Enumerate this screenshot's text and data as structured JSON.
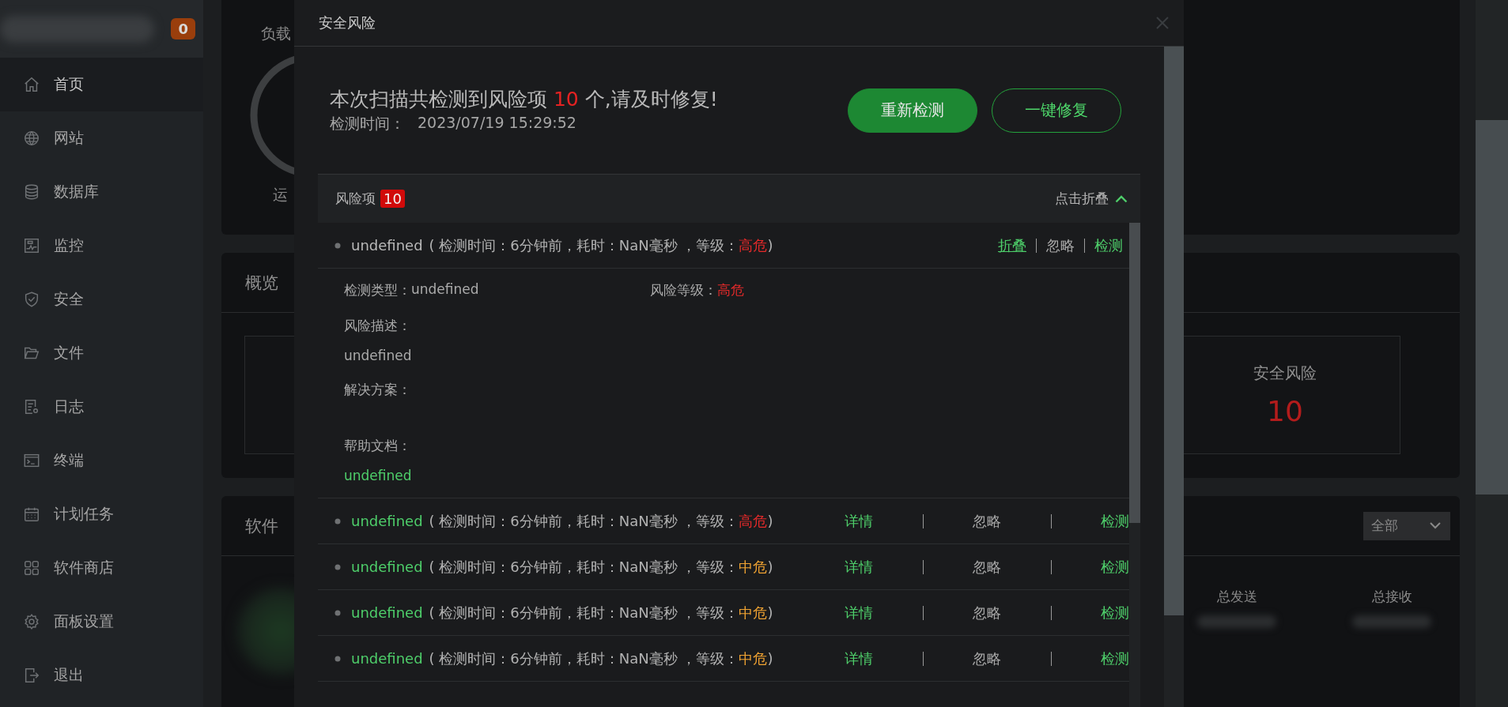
{
  "sidebar": {
    "badge": "0",
    "items": [
      {
        "label": "首页",
        "selected": true
      },
      {
        "label": "网站",
        "selected": false
      },
      {
        "label": "数据库",
        "selected": false
      },
      {
        "label": "监控",
        "selected": false
      },
      {
        "label": "安全",
        "selected": false
      },
      {
        "label": "文件",
        "selected": false
      },
      {
        "label": "日志",
        "selected": false
      },
      {
        "label": "终端",
        "selected": false
      },
      {
        "label": "计划任务",
        "selected": false
      },
      {
        "label": "软件商店",
        "selected": false
      },
      {
        "label": "面板设置",
        "selected": false
      },
      {
        "label": "退出",
        "selected": false
      }
    ]
  },
  "background": {
    "load_title": "负载",
    "load_caption": "运",
    "overview_title": "概览",
    "security_card": {
      "label": "安全风险",
      "value": "10"
    },
    "software_title": "软件",
    "filter_select": "全部",
    "traffic": [
      {
        "label": "总发送"
      },
      {
        "label": "总接收"
      }
    ]
  },
  "modal": {
    "title": "安全风险",
    "summary": {
      "before": "本次扫描共检测到风险项 ",
      "count": "10",
      "after": " 个,请及时修复!"
    },
    "scan_time_label": "检测时间：",
    "scan_time": "2023/07/19 15:29:52",
    "buttons": [
      {
        "label": "重新检测",
        "kind": "primary"
      },
      {
        "label": "一键修复",
        "kind": "outline"
      }
    ],
    "list": {
      "title": "风险项",
      "count": "10",
      "collapse_label": "点击折叠",
      "items": [
        {
          "name": "undefined",
          "meta": "( 检测时间：6分钟前，耗时：NaN毫秒 ，等级：",
          "grade": "高危",
          "close": ")",
          "color": "#e52a2a",
          "expanded": true,
          "actions": [
            {
              "label": "折叠",
              "kind": "link"
            },
            {
              "label": "忽略",
              "kind": "plain"
            },
            {
              "label": "检测",
              "kind": "link"
            }
          ],
          "details": {
            "type_label": "检测类型：",
            "type": "undefined",
            "grade_label": "风险等级：",
            "grade": "高危",
            "desc_label": "风险描述：",
            "desc": "undefined",
            "solution_label": "解决方案：",
            "help_label": "帮助文档：",
            "help": "undefined"
          }
        },
        {
          "name": "undefined",
          "meta": "( 检测时间：6分钟前，耗时：NaN毫秒 ，等级：",
          "grade": "高危",
          "close": ")",
          "color": "#e52a2a",
          "expanded": false,
          "actions": [
            {
              "label": "详情",
              "kind": "link"
            },
            {
              "label": "忽略",
              "kind": "plain"
            },
            {
              "label": "检测",
              "kind": "link"
            }
          ]
        },
        {
          "name": "undefined",
          "meta": "( 检测时间：6分钟前，耗时：NaN毫秒 ，等级：",
          "grade": "中危",
          "close": ")",
          "color": "#f0a332",
          "expanded": false,
          "actions": [
            {
              "label": "详情",
              "kind": "link"
            },
            {
              "label": "忽略",
              "kind": "plain"
            },
            {
              "label": "检测",
              "kind": "link"
            }
          ]
        },
        {
          "name": "undefined",
          "meta": "( 检测时间：6分钟前，耗时：NaN毫秒 ，等级：",
          "grade": "中危",
          "close": ")",
          "color": "#f0a332",
          "expanded": false,
          "actions": [
            {
              "label": "详情",
              "kind": "link"
            },
            {
              "label": "忽略",
              "kind": "plain"
            },
            {
              "label": "检测",
              "kind": "link"
            }
          ]
        },
        {
          "name": "undefined",
          "meta": "( 检测时间：6分钟前，耗时：NaN毫秒 ，等级：",
          "grade": "中危",
          "close": ")",
          "color": "#f0a332",
          "expanded": false,
          "actions": [
            {
              "label": "详情",
              "kind": "link"
            },
            {
              "label": "忽略",
              "kind": "plain"
            },
            {
              "label": "检测",
              "kind": "link"
            }
          ]
        }
      ]
    }
  }
}
